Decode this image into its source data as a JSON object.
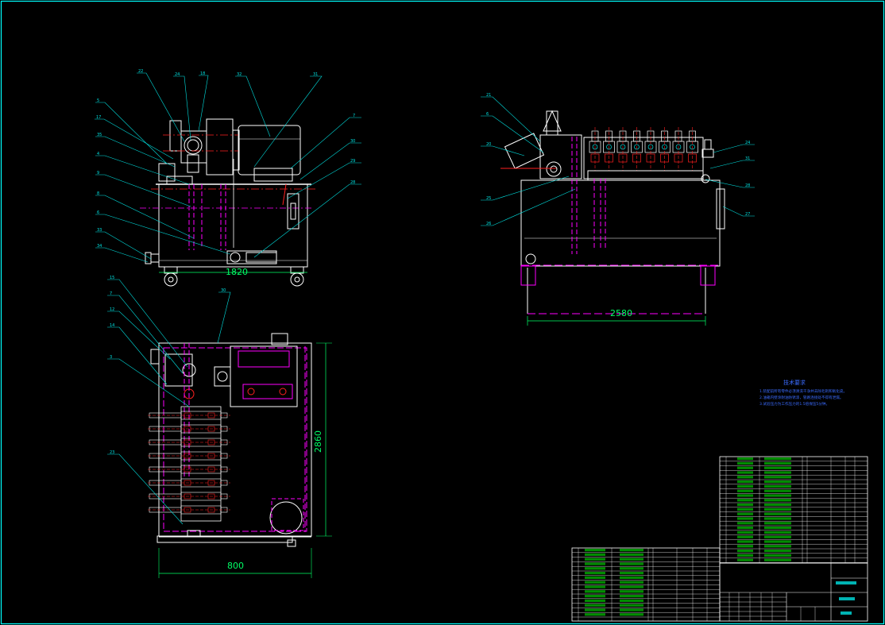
{
  "colors": {
    "background": "#000000",
    "border": "#00ffff",
    "outline": "#ffffff",
    "hidden_line": "#ff00ff",
    "centerline": "#ff2020",
    "dimension": "#00ff66",
    "leader": "#00e0e0",
    "notes": "#3a6bff",
    "table_text": "#00ff00",
    "accent": "#ffff00"
  },
  "dimensions": {
    "front_width": "1820",
    "side_width": "2580",
    "top_width": "800",
    "top_height": "2860"
  },
  "balloons": {
    "front_top": [
      "22",
      "24",
      "18",
      "32",
      "31"
    ],
    "front_left": [
      "5",
      "17",
      "35",
      "4",
      "9",
      "8",
      "6",
      "33",
      "34"
    ],
    "front_right": [
      "7",
      "30",
      "29",
      "28"
    ],
    "side_left": [
      "21",
      "6",
      "20",
      "25",
      "26"
    ],
    "side_right": [
      "24",
      "31",
      "28",
      "27"
    ],
    "top_view": [
      "15",
      "7",
      "12",
      "14",
      "3",
      "30",
      "23"
    ]
  },
  "notes": {
    "title": "技术要求",
    "lines": [
      "1.装配前所有零件必须清洗干净并去除毛刺和氧化皮。",
      "2.油箱内壁涂耐油防锈漆，管路连接处不得有泄漏。",
      "3.试验压力为工作压力的1.5倍保压5分钟。"
    ]
  }
}
